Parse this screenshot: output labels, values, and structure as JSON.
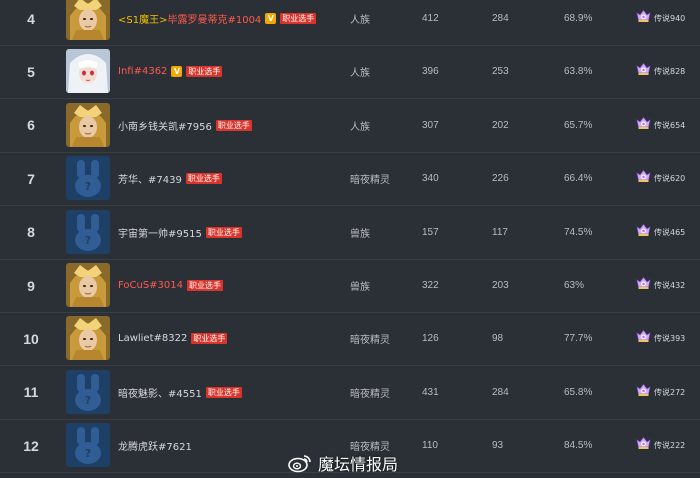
{
  "colors": {
    "background": "#2b2f36",
    "row_border": "#3a3f47",
    "name_red": "#ff5a4f",
    "name_gold": "#f0c000",
    "pro_badge": "#d9342b",
    "v_badge": "#f2a800"
  },
  "badges": {
    "pro_label": "职业选手",
    "v_label": "V"
  },
  "rows": [
    {
      "rank": "4",
      "avatar": "gold-hero-icon",
      "name_prefix": "<S1魔王>",
      "name": "毕露罗曼蒂克#1004",
      "name_color": "red",
      "verified": true,
      "pro": true,
      "race": "人族",
      "games": "412",
      "wins": "284",
      "winrate": "68.9%",
      "rank_icon": "legend-rank-icon",
      "rank_label": "传说940"
    },
    {
      "rank": "5",
      "avatar": "anime-girl-icon",
      "name_prefix": "",
      "name": "Infi#4362",
      "name_color": "red",
      "verified": true,
      "pro": true,
      "race": "人族",
      "games": "396",
      "wins": "253",
      "winrate": "63.8%",
      "rank_icon": "legend-rank-icon",
      "rank_label": "传说828"
    },
    {
      "rank": "6",
      "avatar": "gold-hero-icon",
      "name_prefix": "",
      "name": "小南乡钱关凯#7956",
      "name_color": "normal",
      "verified": false,
      "pro": true,
      "race": "人族",
      "games": "307",
      "wins": "202",
      "winrate": "65.7%",
      "rank_icon": "legend-rank-icon",
      "rank_label": "传说654"
    },
    {
      "rank": "7",
      "avatar": "default-rabbit-icon",
      "name_prefix": "",
      "name": "芳华、#7439",
      "name_color": "normal",
      "verified": false,
      "pro": true,
      "race": "暗夜精灵",
      "games": "340",
      "wins": "226",
      "winrate": "66.4%",
      "rank_icon": "legend-rank-icon",
      "rank_label": "传说620"
    },
    {
      "rank": "8",
      "avatar": "default-rabbit-icon",
      "name_prefix": "",
      "name": "宇宙第一帅#9515",
      "name_color": "normal",
      "verified": false,
      "pro": true,
      "race": "兽族",
      "games": "157",
      "wins": "117",
      "winrate": "74.5%",
      "rank_icon": "legend-rank-icon",
      "rank_label": "传说465"
    },
    {
      "rank": "9",
      "avatar": "gold-hero-icon",
      "name_prefix": "",
      "name": "FoCuS#3014",
      "name_color": "red",
      "verified": false,
      "pro": true,
      "race": "兽族",
      "games": "322",
      "wins": "203",
      "winrate": "63%",
      "rank_icon": "legend-rank-icon",
      "rank_label": "传说432"
    },
    {
      "rank": "10",
      "avatar": "gold-hero-icon",
      "name_prefix": "",
      "name": "Lawliet#8322",
      "name_color": "normal",
      "verified": false,
      "pro": true,
      "race": "暗夜精灵",
      "games": "126",
      "wins": "98",
      "winrate": "77.7%",
      "rank_icon": "legend-rank-icon",
      "rank_label": "传说393"
    },
    {
      "rank": "11",
      "avatar": "default-rabbit-icon",
      "name_prefix": "",
      "name": "暗夜魅影、#4551",
      "name_color": "normal",
      "verified": false,
      "pro": true,
      "race": "暗夜精灵",
      "games": "431",
      "wins": "284",
      "winrate": "65.8%",
      "rank_icon": "legend-rank-icon",
      "rank_label": "传说272"
    },
    {
      "rank": "12",
      "avatar": "default-rabbit-icon",
      "name_prefix": "",
      "name": "龙腾虎跃#7621",
      "name_color": "normal",
      "verified": false,
      "pro": false,
      "race": "暗夜精灵",
      "games": "110",
      "wins": "93",
      "winrate": "84.5%",
      "rank_icon": "legend-rank-icon",
      "rank_label": "传说222"
    }
  ],
  "watermark": {
    "icon": "weibo-icon",
    "text": "魔坛情报局"
  }
}
